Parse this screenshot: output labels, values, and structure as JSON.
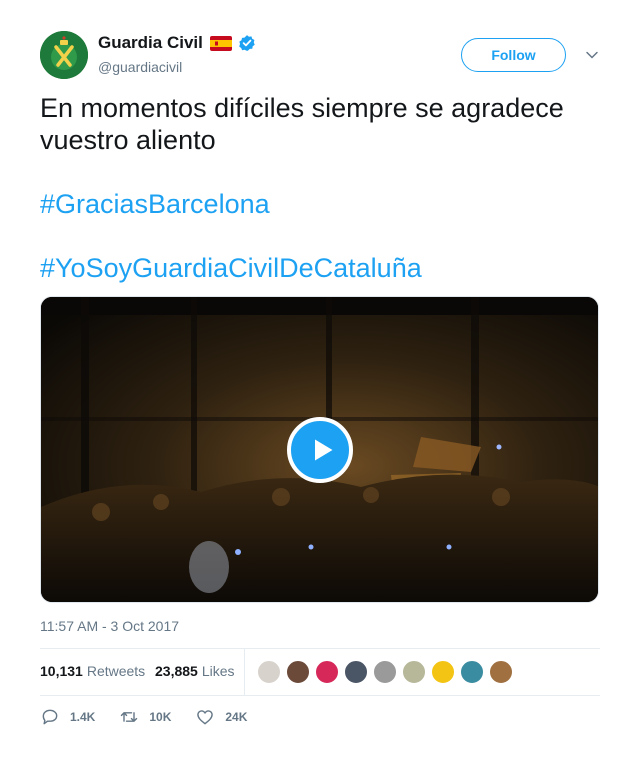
{
  "user": {
    "name": "Guardia Civil",
    "handle": "@guardiacivil",
    "flag_icon": "spain-flag-icon",
    "verified_icon": "verified-badge-icon",
    "avatar_color": "#1e7a3a"
  },
  "header": {
    "follow_label": "Follow",
    "more_icon": "chevron-down-icon"
  },
  "tweet": {
    "text": "En momentos difíciles siempre se agradece vuestro aliento",
    "hashtags": [
      "#GraciasBarcelona",
      "#YoSoyGuardiaCivilDeCataluña"
    ]
  },
  "media": {
    "type": "video",
    "play_icon": "play-icon"
  },
  "timestamp": "11:57 AM - 3 Oct 2017",
  "stats": {
    "retweets_count": "10,131",
    "retweets_label": "Retweets",
    "likes_count": "23,885",
    "likes_label": "Likes"
  },
  "likers": [
    {
      "color": "#d8d2cc"
    },
    {
      "color": "#6b4a3a"
    },
    {
      "color": "#d6295a"
    },
    {
      "color": "#4a5566"
    },
    {
      "color": "#9a9a9a"
    },
    {
      "color": "#b7b79a"
    },
    {
      "color": "#f3c413"
    },
    {
      "color": "#3a8ca0"
    },
    {
      "color": "#a07040"
    }
  ],
  "actions": {
    "reply_count": "1.4K",
    "retweet_count": "10K",
    "like_count": "24K"
  },
  "colors": {
    "link": "#1da1f2",
    "muted": "#657786",
    "text": "#14171a"
  }
}
